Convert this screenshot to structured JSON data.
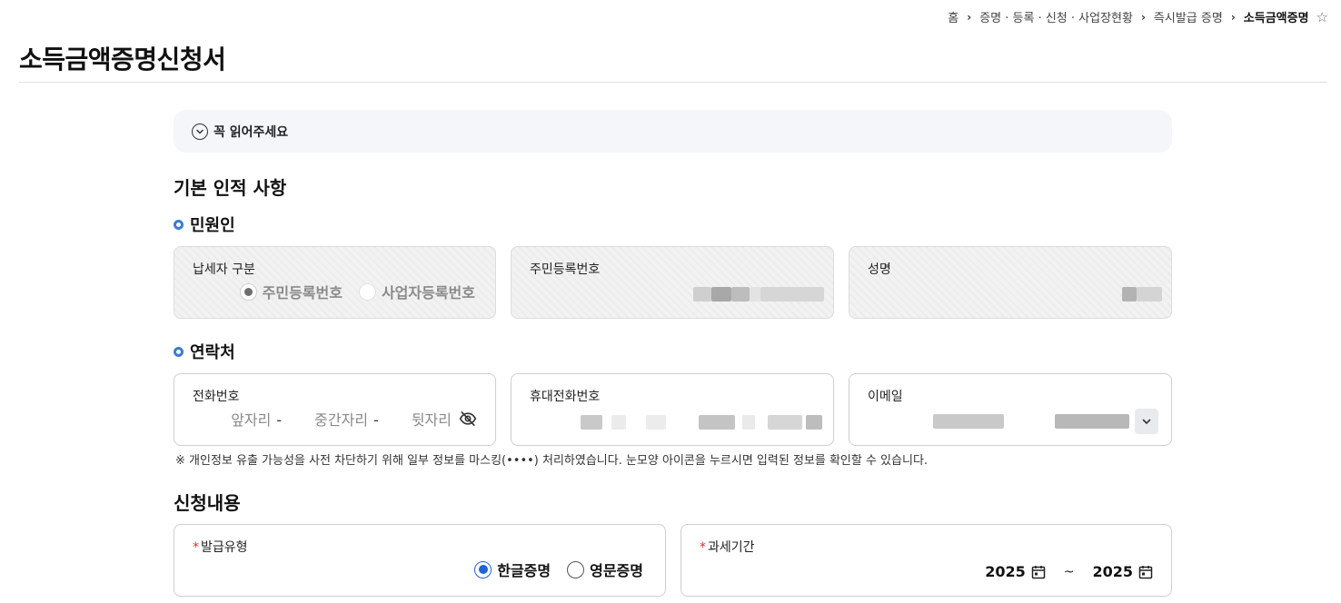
{
  "breadcrumb": {
    "items": [
      "홈",
      "증명 · 등록 · 신청 · 사업장현황",
      "즉시발급 증명",
      "소득금액증명"
    ],
    "separator": "›"
  },
  "page": {
    "title": "소득금액증명신청서"
  },
  "notice": {
    "label": "꼭 읽어주세요"
  },
  "basic_info": {
    "title": "기본 인적 사항",
    "applicant": {
      "title": "민원인",
      "taxpayer_type": {
        "label": "납세자 구분",
        "options": [
          "주민등록번호",
          "사업자등록번호"
        ],
        "selected": "주민등록번호"
      },
      "resident_number": {
        "label": "주민등록번호"
      },
      "name": {
        "label": "성명"
      }
    },
    "contact": {
      "title": "연락처",
      "phone": {
        "label": "전화번호",
        "parts": [
          "앞자리",
          "중간자리",
          "뒷자리"
        ],
        "dash": "-"
      },
      "mobile": {
        "label": "휴대전화번호"
      },
      "email": {
        "label": "이메일"
      }
    },
    "masking_note": "※ 개인정보 유출 가능성을 사전 차단하기 위해 일부 정보를 마스킹(••••) 처리하였습니다. 눈모양 아이콘을 누르시면 입력된 정보를 확인할 수 있습니다."
  },
  "application": {
    "title": "신청내용",
    "issue_type": {
      "label": "발급유형",
      "required_mark": "*",
      "options": [
        "한글증명",
        "영문증명"
      ],
      "selected": "한글증명"
    },
    "tax_period": {
      "label": "과세기간",
      "required_mark": "*",
      "from": "2025",
      "to": "2025",
      "separator": "~"
    }
  },
  "colors": {
    "accent": "#1f63d8",
    "section_dot": "#3a7bd5",
    "required": "#e0322b",
    "notice_bg": "#f4f6fa"
  }
}
